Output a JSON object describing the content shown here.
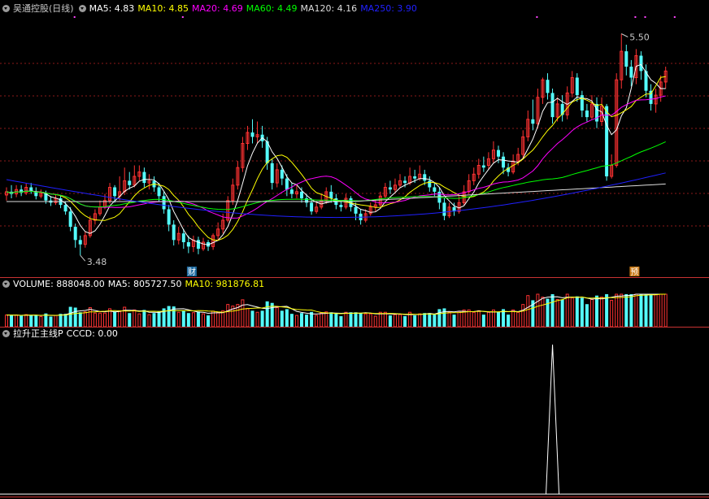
{
  "main": {
    "title": "吴通控股(日线)",
    "ma_labels": [
      {
        "text": "MA5: 4.83",
        "color": "#ffffff"
      },
      {
        "text": "MA10: 4.85",
        "color": "#ffff00"
      },
      {
        "text": "MA20: 4.69",
        "color": "#ff00ff"
      },
      {
        "text": "MA60: 4.49",
        "color": "#00ff00"
      },
      {
        "text": "MA120: 4.16",
        "color": "#dddddd"
      },
      {
        "text": "MA250: 3.90",
        "color": "#2020ff"
      }
    ],
    "high_label": "5.50",
    "low_label": "3.48",
    "markers": [
      {
        "text": "财",
        "idx": 38
      },
      {
        "text": "预",
        "idx": 128
      }
    ]
  },
  "volume": {
    "labels": [
      {
        "text": "VOLUME: 888048.00",
        "color": "#ffffff"
      },
      {
        "text": "MA5: 805727.50",
        "color": "#ffffff"
      },
      {
        "text": "MA10: 981876.81",
        "color": "#ffff00"
      }
    ]
  },
  "indicator": {
    "labels": [
      {
        "text": "拉升正主线P",
        "color": "#ffffff"
      },
      {
        "text": "CCCD: 0.00",
        "color": "#ffffff"
      }
    ]
  },
  "colors": {
    "up": "#ff3232",
    "down": "#54fcfc",
    "grid": "#8b1a1a",
    "separator": "#c83232",
    "ma5": "#ffffff",
    "ma10": "#ffff00",
    "ma20": "#ff00ff",
    "ma60": "#00ff00",
    "ma120": "#dddddd",
    "ma250": "#2020ff"
  },
  "chart_data": {
    "type": "candlestick",
    "price_range": [
      3.4,
      5.6
    ],
    "candles": [
      [
        4.03,
        4.06,
        4.1,
        3.98
      ],
      [
        4.06,
        4.04,
        4.12,
        4.0
      ],
      [
        4.04,
        4.08,
        4.12,
        4.01
      ],
      [
        4.08,
        4.05,
        4.12,
        4.02
      ],
      [
        4.05,
        4.1,
        4.14,
        4.03
      ],
      [
        4.1,
        4.06,
        4.14,
        4.04
      ],
      [
        4.06,
        4.02,
        4.1,
        3.99
      ],
      [
        4.02,
        4.05,
        4.08,
        4.0
      ],
      [
        4.05,
        3.98,
        4.07,
        3.95
      ],
      [
        3.98,
        3.96,
        4.02,
        3.93
      ],
      [
        3.96,
        4.0,
        4.04,
        3.94
      ],
      [
        4.0,
        3.94,
        4.03,
        3.91
      ],
      [
        3.94,
        3.88,
        3.97,
        3.85
      ],
      [
        3.88,
        3.74,
        3.92,
        3.7
      ],
      [
        3.74,
        3.62,
        3.77,
        3.55
      ],
      [
        3.62,
        3.58,
        3.66,
        3.48
      ],
      [
        3.58,
        3.66,
        3.7,
        3.55
      ],
      [
        3.66,
        3.8,
        3.84,
        3.64
      ],
      [
        3.8,
        3.86,
        3.9,
        3.76
      ],
      [
        3.86,
        3.92,
        3.98,
        3.84
      ],
      [
        3.92,
        3.98,
        4.04,
        3.9
      ],
      [
        3.98,
        4.1,
        4.14,
        3.95
      ],
      [
        4.1,
        4.02,
        4.12,
        3.96
      ],
      [
        4.02,
        4.06,
        4.2,
        3.98
      ],
      [
        4.06,
        4.16,
        4.28,
        4.03
      ],
      [
        4.16,
        4.12,
        4.24,
        4.08
      ],
      [
        4.12,
        4.2,
        4.3,
        4.1
      ],
      [
        4.2,
        4.24,
        4.3,
        4.16
      ],
      [
        4.24,
        4.14,
        4.28,
        4.1
      ],
      [
        4.14,
        4.16,
        4.22,
        4.08
      ],
      [
        4.16,
        4.1,
        4.2,
        4.06
      ],
      [
        4.1,
        4.02,
        4.14,
        3.97
      ],
      [
        4.02,
        3.9,
        4.06,
        3.86
      ],
      [
        3.9,
        3.76,
        3.94,
        3.7
      ],
      [
        3.76,
        3.62,
        3.8,
        3.57
      ],
      [
        3.62,
        3.68,
        3.74,
        3.58
      ],
      [
        3.68,
        3.6,
        3.72,
        3.54
      ],
      [
        3.6,
        3.56,
        3.66,
        3.5
      ],
      [
        3.56,
        3.62,
        3.66,
        3.51
      ],
      [
        3.62,
        3.54,
        3.65,
        3.49
      ],
      [
        3.54,
        3.6,
        3.64,
        3.52
      ],
      [
        3.6,
        3.56,
        3.62,
        3.52
      ],
      [
        3.56,
        3.66,
        3.68,
        3.53
      ],
      [
        3.66,
        3.72,
        3.78,
        3.62
      ],
      [
        3.72,
        3.8,
        3.86,
        3.68
      ],
      [
        3.8,
        3.98,
        4.02,
        3.78
      ],
      [
        3.98,
        4.12,
        4.18,
        3.94
      ],
      [
        4.12,
        4.28,
        4.34,
        4.08
      ],
      [
        4.28,
        4.5,
        4.56,
        4.24
      ],
      [
        4.5,
        4.6,
        4.66,
        4.44
      ],
      [
        4.6,
        4.56,
        4.72,
        4.5
      ],
      [
        4.56,
        4.58,
        4.7,
        4.5
      ],
      [
        4.58,
        4.52,
        4.66,
        4.46
      ],
      [
        4.52,
        4.32,
        4.56,
        4.26
      ],
      [
        4.32,
        4.14,
        4.36,
        4.08
      ],
      [
        4.14,
        4.26,
        4.32,
        4.1
      ],
      [
        4.26,
        4.18,
        4.3,
        4.12
      ],
      [
        4.18,
        4.08,
        4.22,
        4.02
      ],
      [
        4.08,
        4.04,
        4.14,
        4.0
      ],
      [
        4.04,
        4.06,
        4.12,
        4.0
      ],
      [
        4.06,
        4.0,
        4.1,
        3.96
      ],
      [
        4.0,
        3.96,
        4.04,
        3.92
      ],
      [
        3.96,
        3.88,
        4.0,
        3.85
      ],
      [
        3.88,
        3.92,
        3.96,
        3.86
      ],
      [
        3.92,
        3.98,
        4.04,
        3.9
      ],
      [
        3.98,
        4.06,
        4.1,
        3.95
      ],
      [
        4.06,
        4.0,
        4.12,
        3.96
      ],
      [
        4.0,
        3.94,
        4.04,
        3.9
      ],
      [
        3.94,
        3.92,
        3.98,
        3.88
      ],
      [
        3.92,
        4.0,
        4.04,
        3.9
      ],
      [
        4.0,
        3.92,
        4.02,
        3.88
      ],
      [
        3.92,
        3.86,
        3.96,
        3.8
      ],
      [
        3.86,
        3.8,
        3.9,
        3.76
      ],
      [
        3.8,
        3.86,
        3.9,
        3.78
      ],
      [
        3.86,
        3.92,
        3.96,
        3.84
      ],
      [
        3.92,
        3.94,
        3.98,
        3.88
      ],
      [
        3.94,
        4.02,
        4.06,
        3.92
      ],
      [
        4.02,
        4.1,
        4.14,
        4.0
      ],
      [
        4.1,
        4.08,
        4.16,
        4.04
      ],
      [
        4.08,
        4.12,
        4.18,
        4.06
      ],
      [
        4.12,
        4.16,
        4.22,
        4.1
      ],
      [
        4.16,
        4.14,
        4.2,
        4.1
      ],
      [
        4.14,
        4.2,
        4.28,
        4.12
      ],
      [
        4.2,
        4.18,
        4.26,
        4.14
      ],
      [
        4.18,
        4.22,
        4.3,
        4.16
      ],
      [
        4.22,
        4.16,
        4.26,
        4.12
      ],
      [
        4.16,
        4.1,
        4.2,
        4.06
      ],
      [
        4.1,
        4.06,
        4.14,
        4.02
      ],
      [
        4.06,
        3.96,
        4.1,
        3.9
      ],
      [
        3.96,
        3.84,
        4.0,
        3.8
      ],
      [
        3.84,
        3.92,
        3.96,
        3.82
      ],
      [
        3.92,
        3.88,
        3.96,
        3.84
      ],
      [
        3.88,
        3.96,
        4.02,
        3.86
      ],
      [
        3.96,
        4.06,
        4.12,
        3.94
      ],
      [
        4.06,
        4.16,
        4.22,
        4.04
      ],
      [
        4.16,
        4.22,
        4.28,
        4.12
      ],
      [
        4.22,
        4.3,
        4.36,
        4.18
      ],
      [
        4.3,
        4.28,
        4.38,
        4.24
      ],
      [
        4.3,
        4.36,
        4.42,
        4.26
      ],
      [
        4.36,
        4.44,
        4.52,
        4.32
      ],
      [
        4.44,
        4.38,
        4.48,
        4.32
      ],
      [
        4.38,
        4.28,
        4.42,
        4.22
      ],
      [
        4.28,
        4.24,
        4.32,
        4.2
      ],
      [
        4.24,
        4.34,
        4.4,
        4.22
      ],
      [
        4.34,
        4.4,
        4.46,
        4.3
      ],
      [
        4.4,
        4.56,
        4.62,
        4.36
      ],
      [
        4.56,
        4.72,
        4.8,
        4.52
      ],
      [
        4.72,
        4.68,
        4.9,
        4.62
      ],
      [
        4.68,
        4.92,
        5.0,
        4.64
      ],
      [
        4.92,
        5.08,
        5.1,
        4.86
      ],
      [
        5.08,
        4.96,
        5.14,
        4.9
      ],
      [
        4.96,
        4.74,
        5.0,
        4.68
      ],
      [
        4.74,
        4.86,
        4.92,
        4.7
      ],
      [
        4.86,
        4.76,
        4.94,
        4.7
      ],
      [
        4.76,
        4.96,
        5.02,
        4.72
      ],
      [
        4.96,
        5.1,
        5.16,
        4.92
      ],
      [
        5.1,
        4.94,
        5.14,
        4.88
      ],
      [
        4.94,
        4.8,
        4.98,
        4.74
      ],
      [
        4.8,
        4.74,
        4.86,
        4.7
      ],
      [
        4.74,
        4.86,
        4.94,
        4.72
      ],
      [
        4.86,
        4.7,
        4.92,
        4.64
      ],
      [
        4.7,
        4.84,
        4.92,
        4.66
      ],
      [
        4.84,
        4.2,
        4.86,
        4.16
      ],
      [
        4.2,
        4.3,
        4.4,
        4.18
      ],
      [
        4.3,
        5.08,
        5.14,
        4.28
      ],
      [
        5.08,
        5.34,
        5.5,
        5.0
      ],
      [
        5.34,
        5.2,
        5.4,
        5.12
      ],
      [
        5.2,
        5.1,
        5.26,
        5.02
      ],
      [
        5.1,
        5.3,
        5.36,
        5.04
      ],
      [
        5.3,
        5.16,
        5.34,
        5.08
      ],
      [
        5.16,
        4.98,
        5.22,
        4.92
      ],
      [
        4.98,
        4.86,
        5.04,
        4.8
      ],
      [
        4.86,
        4.94,
        5.0,
        4.78
      ],
      [
        4.94,
        5.06,
        5.12,
        4.88
      ],
      [
        5.06,
        5.16,
        5.2,
        5.0
      ]
    ]
  }
}
